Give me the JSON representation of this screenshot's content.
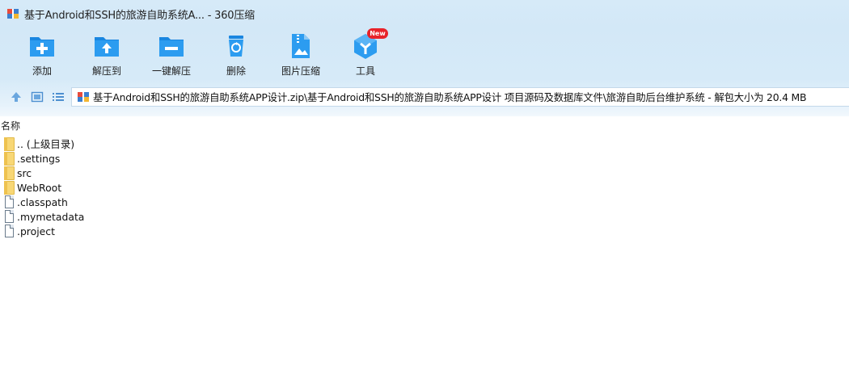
{
  "window": {
    "title": "基于Android和SSH的旅游自助系统A... - 360压缩",
    "icon": "zip-archive-icon"
  },
  "toolbar": {
    "items": [
      {
        "label": "添加",
        "icon": "add-folder-icon"
      },
      {
        "label": "解压到",
        "icon": "extract-to-icon"
      },
      {
        "label": "一键解压",
        "icon": "one-click-extract-icon"
      },
      {
        "label": "删除",
        "icon": "delete-bin-icon"
      },
      {
        "label": "图片压缩",
        "icon": "image-compress-icon"
      },
      {
        "label": "工具",
        "icon": "tools-cube-icon",
        "badge": "New"
      }
    ]
  },
  "address": {
    "path": "基于Android和SSH的旅游自助系统APP设计.zip\\基于Android和SSH的旅游自助系统APP设计 项目源码及数据库文件\\旅游自助后台维护系统 - 解包大小为 20.4 MB",
    "nav_icons": [
      "up-arrow-icon",
      "thumbnail-view-icon",
      "list-view-icon"
    ]
  },
  "file_list": {
    "column_name": "名称",
    "rows": [
      {
        "name": ".. (上级目录)",
        "type": "folder"
      },
      {
        "name": ".settings",
        "type": "folder"
      },
      {
        "name": "src",
        "type": "folder"
      },
      {
        "name": "WebRoot",
        "type": "folder"
      },
      {
        "name": ".classpath",
        "type": "file"
      },
      {
        "name": ".mymetadata",
        "type": "file"
      },
      {
        "name": ".project",
        "type": "file"
      }
    ]
  },
  "colors": {
    "accent_blue": "#2c9cf0",
    "chrome_bg": "#d6eaf8",
    "badge_red": "#e8232a",
    "folder_yellow": "#f8d775"
  }
}
